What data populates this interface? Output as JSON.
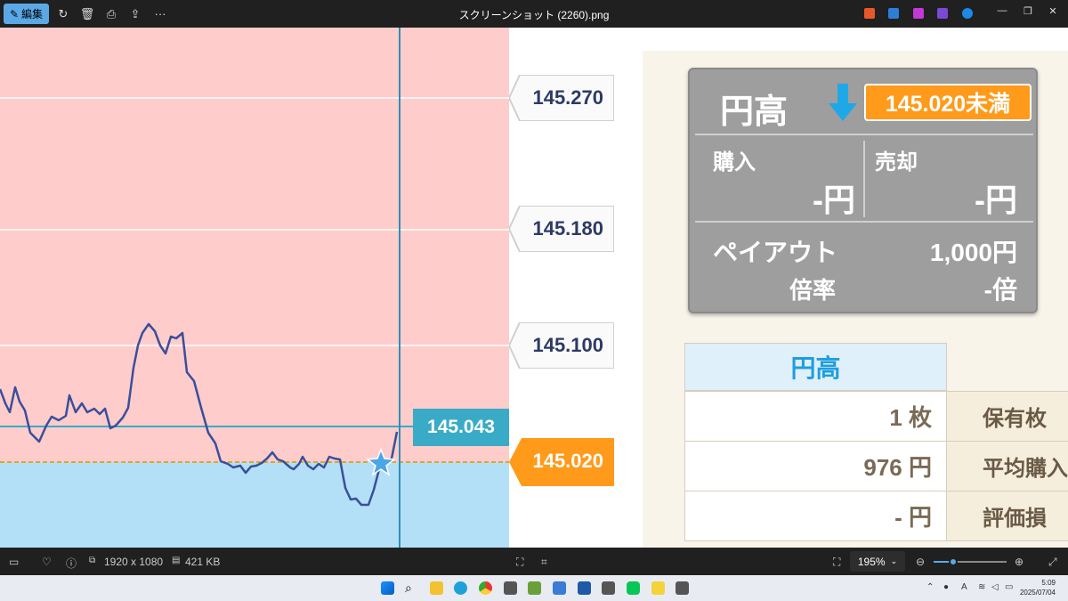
{
  "window": {
    "title": "スクリーンショット (2260).png",
    "edit_label": "編集"
  },
  "chart": {
    "price_labels": [
      "145.270",
      "145.180",
      "145.100"
    ],
    "target_price": "145.020",
    "current_price": "145.043"
  },
  "card": {
    "title": "円高",
    "badge": "145.020未満",
    "buy_label": "購入",
    "buy_value": "-円",
    "sell_label": "売却",
    "sell_value": "-円",
    "payout_label": "ペイアウト",
    "payout_value": "1,000円",
    "ratio_label": "倍率",
    "ratio_value": "-倍"
  },
  "table": {
    "header": "円高",
    "rows": [
      {
        "value": "1 枚",
        "label": "保有枚"
      },
      {
        "value": "976 円",
        "label": "平均購入"
      },
      {
        "value": "- 円",
        "label": "評価損"
      }
    ]
  },
  "status": {
    "dimensions": "1920 x 1080",
    "filesize": "421 KB",
    "zoom": "195%",
    "zoom_fraction": 0.27
  },
  "taskbar": {
    "time": "5:09",
    "date": "2025/07/04"
  },
  "colors": {
    "upper_zone": "#ffcccc",
    "lower_zone": "#b3e0f7",
    "line": "#3a4f9a",
    "current": "#3aabc6",
    "target": "#ff9a1a"
  }
}
